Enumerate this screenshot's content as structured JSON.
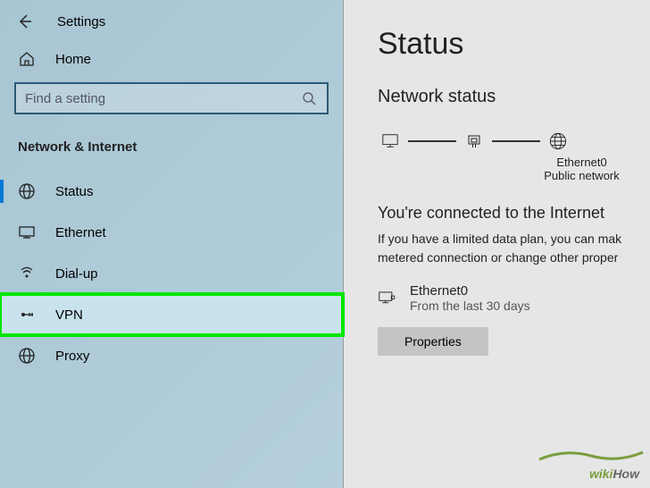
{
  "header": {
    "title": "Settings"
  },
  "home": {
    "label": "Home"
  },
  "search": {
    "placeholder": "Find a setting"
  },
  "section": {
    "title": "Network & Internet"
  },
  "nav": {
    "status": "Status",
    "ethernet": "Ethernet",
    "dialup": "Dial-up",
    "vpn": "VPN",
    "proxy": "Proxy"
  },
  "main": {
    "title": "Status",
    "subhead": "Network status",
    "diagram": {
      "adapter": "Ethernet0",
      "network_type": "Public network"
    },
    "connected": {
      "title": "You're connected to the Internet",
      "desc1": "If you have a limited data plan, you can mak",
      "desc2": "metered connection or change other proper"
    },
    "adapter": {
      "name": "Ethernet0",
      "sub": "From the last 30 days"
    },
    "buttons": {
      "properties": "Properties"
    }
  },
  "watermark": {
    "wiki": "wiki",
    "how": "How"
  }
}
